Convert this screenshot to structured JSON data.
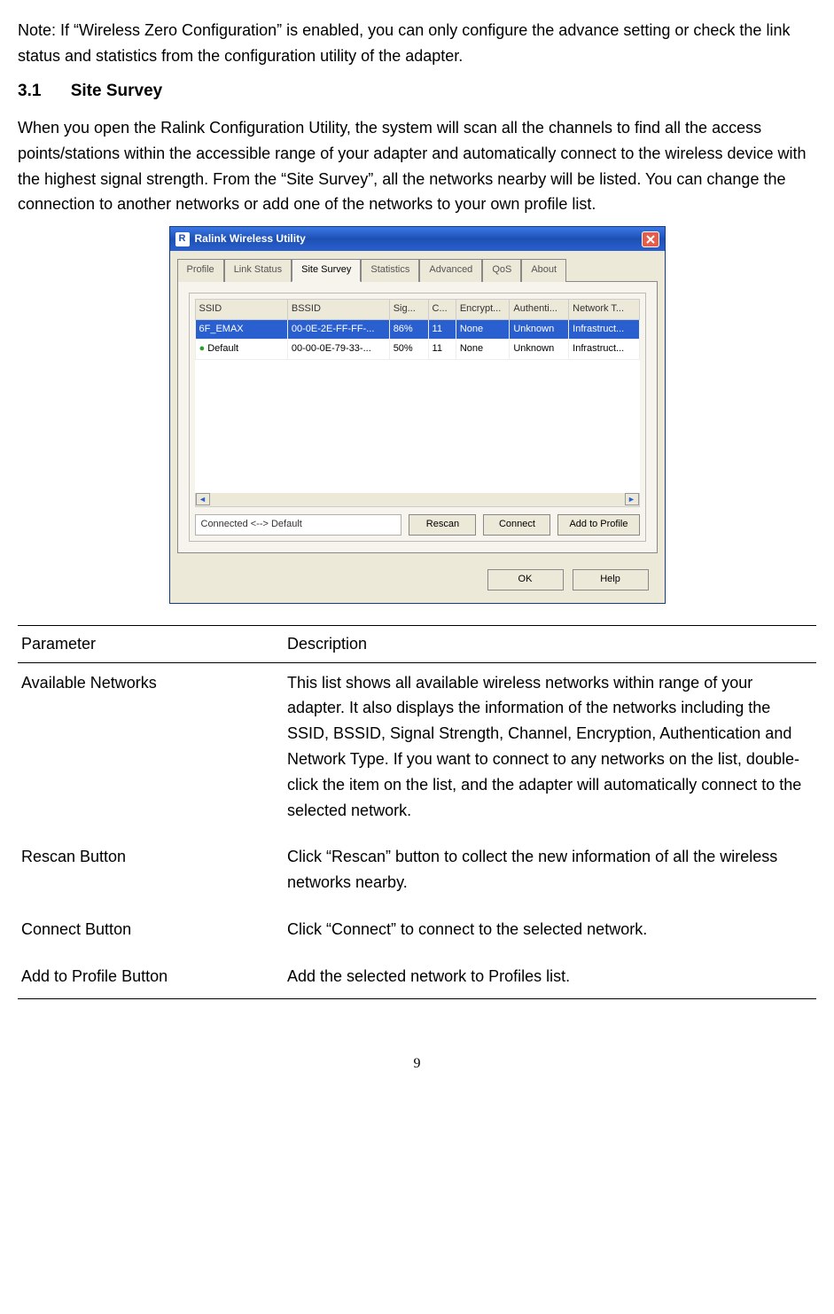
{
  "note_text": "Note: If “Wireless Zero Configuration” is enabled, you can only configure the advance setting or check the link status and statistics from the configuration utility of the adapter.",
  "section": {
    "number": "3.1",
    "title": "Site Survey"
  },
  "intro_text": "When you open the Ralink Configuration Utility, the system will scan all the channels to find all the access points/stations within the accessible range of your adapter and automatically connect to the wireless device with the highest signal strength. From the “Site Survey”, all the networks nearby will be listed. You can change the connection to another networks or add one of the networks to your own profile list.",
  "window": {
    "title": "Ralink Wireless Utility",
    "app_icon_letter": "R",
    "tabs": [
      "Profile",
      "Link Status",
      "Site Survey",
      "Statistics",
      "Advanced",
      "QoS",
      "About"
    ],
    "active_tab_index": 2,
    "columns": [
      "SSID",
      "BSSID",
      "Sig...",
      "C...",
      "Encrypt...",
      "Authenti...",
      "Network T..."
    ],
    "rows": [
      {
        "ssid": "6F_EMAX",
        "bssid": "00-0E-2E-FF-FF-...",
        "signal": "86%",
        "channel": "11",
        "encrypt": "None",
        "auth": "Unknown",
        "net": "Infrastruct...",
        "selected": true,
        "connected": false
      },
      {
        "ssid": "Default",
        "bssid": "00-00-0E-79-33-...",
        "signal": "50%",
        "channel": "11",
        "encrypt": "None",
        "auth": "Unknown",
        "net": "Infrastruct...",
        "selected": false,
        "connected": true
      }
    ],
    "status_text": "Connected <--> Default",
    "buttons": {
      "rescan": "Rescan",
      "connect": "Connect",
      "add_profile": "Add to Profile",
      "ok": "OK",
      "help": "Help"
    }
  },
  "param_table": {
    "headers": [
      "Parameter",
      "Description"
    ],
    "rows": [
      {
        "param": "Available Networks",
        "desc": "This list shows all available wireless networks within range of your adapter. It also displays the information of the networks including the SSID, BSSID, Signal Strength, Channel, Encryption, Authentication and Network Type. If you want to connect to any networks on the list, double-click the item on the list, and the adapter will automatically connect to the selected network."
      },
      {
        "param": "Rescan Button",
        "desc": "Click “Rescan” button to collect the new information of all the wireless networks nearby."
      },
      {
        "param": "Connect Button",
        "desc": "Click “Connect” to connect to the selected network."
      },
      {
        "param": "Add to Profile Button",
        "desc": "Add the selected network to Profiles list."
      }
    ]
  },
  "page_number": "9"
}
